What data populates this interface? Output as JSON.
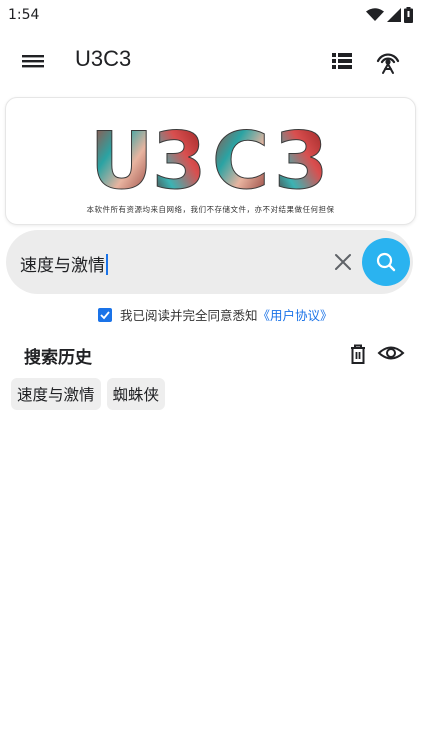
{
  "status_bar": {
    "time": "1:54",
    "icons": [
      "wifi-icon",
      "signal-icon",
      "battery-icon"
    ]
  },
  "app_bar": {
    "title": "U3C3",
    "icons": [
      "menu-icon",
      "list-view-icon",
      "antenna-icon"
    ]
  },
  "banner": {
    "logo_text": "U3C3",
    "subtitle": "本软件所有资源均来自网络，我们不存储文件，亦不对结果做任何担保"
  },
  "search": {
    "value": "速度与激情",
    "icons": [
      "clear-icon",
      "search-icon"
    ]
  },
  "agreement": {
    "checked": true,
    "text": "我已阅读并完全同意悉知",
    "link": "《用户协议》"
  },
  "history": {
    "title": "搜索历史",
    "icons": [
      "trash-icon",
      "eye-icon"
    ],
    "items": [
      "速度与激情",
      "蜘蛛侠"
    ]
  },
  "colors": {
    "accent": "#2ab3f0",
    "link": "#1a73e8",
    "search_bg": "#ececec",
    "chip_bg": "#eeeeee"
  }
}
